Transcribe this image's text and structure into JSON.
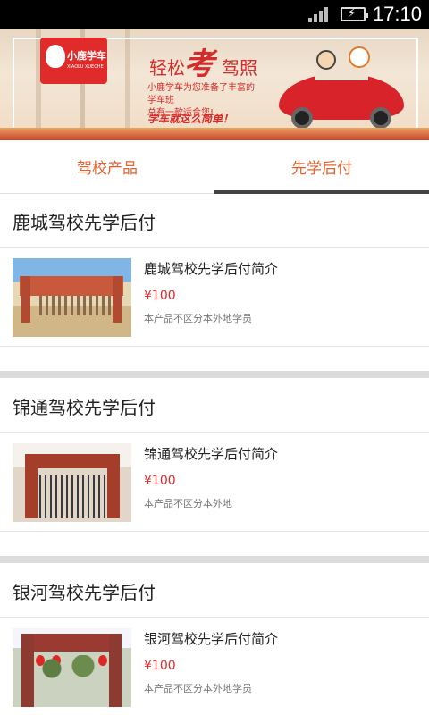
{
  "status_bar": {
    "time": "17:10"
  },
  "banner": {
    "logo_text": "小鹿学车",
    "logo_sub": "XIAOLU XUECHE",
    "title_a": "轻松",
    "title_b": "考",
    "title_c": "驾照",
    "desc_line1": "小鹿学车为您准备了丰富的学车班",
    "desc_line2": "总有一款适合您!",
    "slogan": "学车就这么简单！",
    "accent_color": "#d42b2b"
  },
  "tabs": [
    {
      "label": "驾校产品",
      "active": false
    },
    {
      "label": "先学后付",
      "active": true
    }
  ],
  "sections": [
    {
      "title": "鹿城驾校先学后付",
      "item": {
        "name": "鹿城驾校先学后付简介",
        "price": "¥100",
        "note": "本产品不区分本外地学员"
      }
    },
    {
      "title": "锦通驾校先学后付",
      "item": {
        "name": "锦通驾校先学后付简介",
        "price": "¥100",
        "note": "本产品不区分本外地"
      }
    },
    {
      "title": "银河驾校先学后付",
      "item": {
        "name": "银河驾校先学后付简介",
        "price": "¥100",
        "note": "本产品不区分本外地学员"
      }
    }
  ],
  "colors": {
    "accent": "#e8612c",
    "price": "#e12b2b",
    "separator": "#dcdcdc"
  },
  "icons": [
    "signal-icon",
    "battery-charging-icon",
    "mobile-data-icon",
    "school-gate-photo"
  ]
}
